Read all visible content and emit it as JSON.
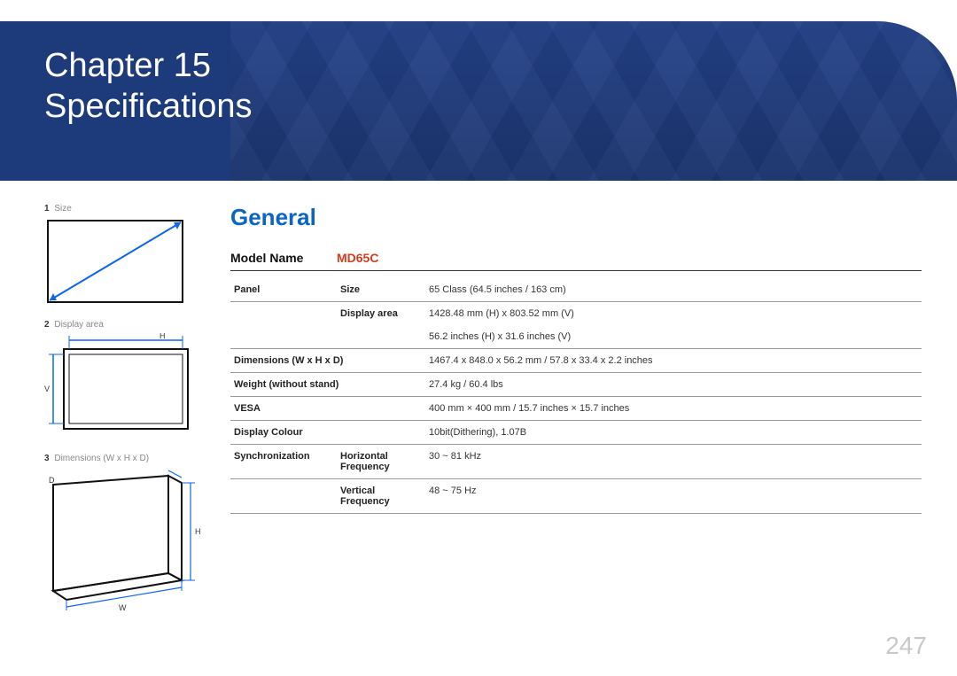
{
  "header": {
    "chapter_prefix": "Chapter",
    "chapter_number": "15",
    "title": "Specifications"
  },
  "figures": {
    "f1": {
      "num": "1",
      "label": "Size"
    },
    "f2": {
      "num": "2",
      "label": "Display area",
      "h": "H",
      "v": "V"
    },
    "f3": {
      "num": "3",
      "label": "Dimensions (W x H x D)",
      "w": "W",
      "h": "H",
      "d": "D"
    }
  },
  "section_title": "General",
  "model": {
    "label": "Model Name",
    "value": "MD65C"
  },
  "rows": {
    "panel_cat": "Panel",
    "size_label": "Size",
    "size_val": "65 Class (64.5 inches / 163 cm)",
    "disp_label": "Display area",
    "disp_val1": "1428.48 mm (H) x 803.52 mm (V)",
    "disp_val2": "56.2 inches (H) x 31.6 inches (V)",
    "dim_label": "Dimensions (W x H x D)",
    "dim_val": "1467.4 x 848.0 x 56.2 mm / 57.8 x 33.4 x 2.2 inches",
    "wt_label": "Weight (without stand)",
    "wt_val": "27.4 kg / 60.4 lbs",
    "vesa_label": "VESA",
    "vesa_val": "400 mm × 400 mm / 15.7 inches × 15.7 inches",
    "color_label": "Display Colour",
    "color_val": "10bit(Dithering), 1.07B",
    "sync_cat": "Synchronization",
    "hf_label": "Horizontal Frequency",
    "hf_val": "30 ~ 81 kHz",
    "vf_label": "Vertical Frequency",
    "vf_val": "48 ~ 75 Hz"
  },
  "page_number": "247"
}
